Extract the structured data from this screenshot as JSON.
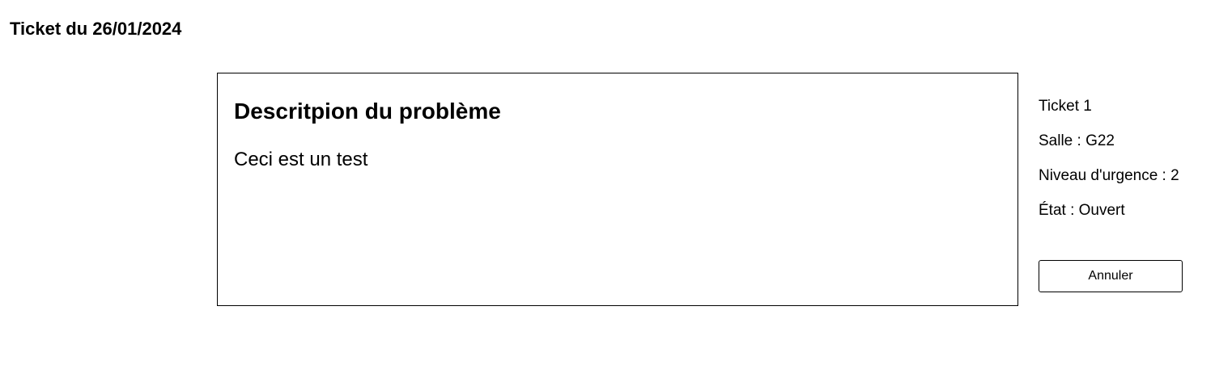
{
  "page": {
    "title": "Ticket du 26/01/2024"
  },
  "description": {
    "heading": "Descritpion du problème",
    "text": "Ceci est un test"
  },
  "info": {
    "ticket": "Ticket 1",
    "room": "Salle : G22",
    "urgency": "Niveau d'urgence : 2",
    "state": "État : Ouvert"
  },
  "actions": {
    "cancel_label": "Annuler"
  }
}
